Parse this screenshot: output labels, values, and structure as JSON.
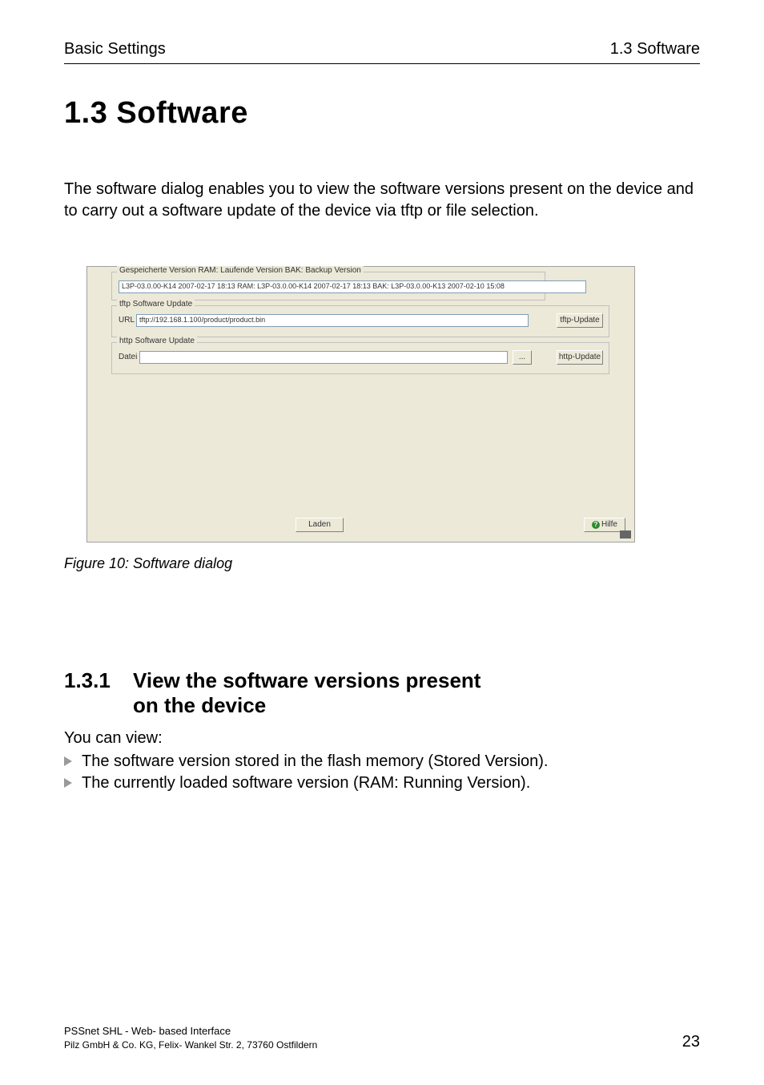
{
  "header": {
    "left": "Basic Settings",
    "right": "1.3 Software"
  },
  "title": "1.3   Software",
  "intro": "The software dialog enables you to view the software versions present on the device and to carry out a software update of the device via tftp or file selection.",
  "screenshot": {
    "versions_legend": "Gespeicherte Version  RAM: Laufende Version BAK: Backup Version",
    "versions_value": "L3P-03.0.00-K14 2007-02-17 18:13 RAM: L3P-03.0.00-K14 2007-02-17 18:13 BAK: L3P-03.0.00-K13 2007-02-10 15:08",
    "tftp_legend": "tftp Software Update",
    "tftp_label": "URL",
    "tftp_value": "tftp://192.168.1.100/product/product.bin",
    "tftp_button": "tftp-Update",
    "http_legend": "http Software Update",
    "http_label": "Datei",
    "http_dots": "...",
    "http_button": "http-Update",
    "laden_button": "Laden",
    "hilfe_button": "Hilfe"
  },
  "figure_caption": "Figure 10: Software dialog",
  "subheading": {
    "number": "1.3.1",
    "line1": "View the software versions present",
    "line2": "on the device"
  },
  "lead": "You can view:",
  "bullets": [
    "The software version stored in the flash memory (Stored Version).",
    "The currently loaded software version (RAM: Running Version)."
  ],
  "footer": {
    "line1": "PSSnet SHL - Web- based Interface",
    "line2": "Pilz GmbH & Co. KG, Felix- Wankel Str. 2, 73760 Ostfildern",
    "page": "23"
  }
}
